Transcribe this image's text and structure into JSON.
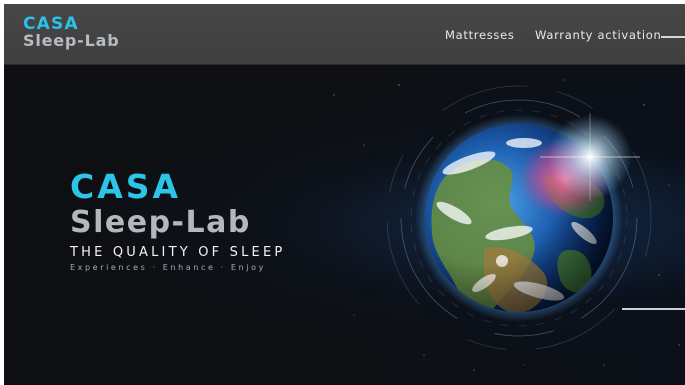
{
  "header": {
    "logo": {
      "line1": "CASA",
      "line2": "Sleep-Lab"
    },
    "nav": [
      {
        "label": "Mattresses"
      },
      {
        "label": "Warranty activation"
      }
    ]
  },
  "hero": {
    "logo": {
      "line1": "CASA",
      "line2": "Sleep-Lab"
    },
    "tagline": "THE QUALITY OF SLEEP",
    "subline": "Experiences · Enhance · Enjoy",
    "image": "earth-from-space"
  },
  "colors": {
    "accent": "#2dc4e8",
    "logo_grey": "#b4b8bd",
    "topbar": "#434343",
    "hero_bg": "#0d0f13"
  }
}
